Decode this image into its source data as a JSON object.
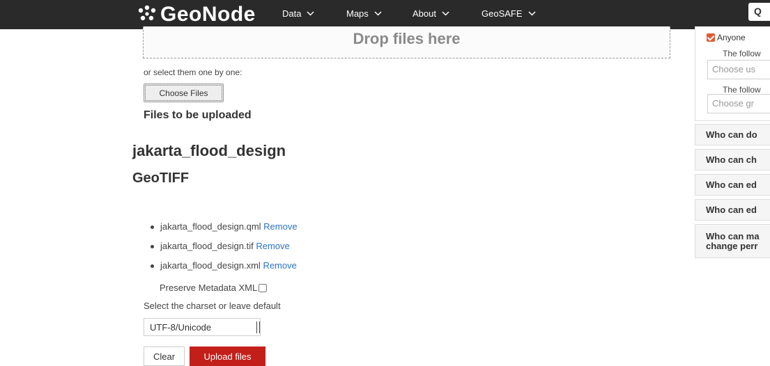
{
  "navbar": {
    "brand": "GeoNode",
    "items": [
      "Data",
      "Maps",
      "About",
      "GeoSAFE"
    ],
    "search_partial": "Q"
  },
  "upload": {
    "drop_text": "Drop files here",
    "select_text": "or select them one by one:",
    "choose_files_label": "Choose Files",
    "files_heading": "Files to be uploaded"
  },
  "layer": {
    "name": "jakarta_flood_design",
    "type": "GeoTIFF",
    "files": [
      {
        "name": "jakarta_flood_design.qml",
        "remove": "Remove"
      },
      {
        "name": "jakarta_flood_design.tif",
        "remove": "Remove"
      },
      {
        "name": "jakarta_flood_design.xml",
        "remove": "Remove"
      }
    ],
    "preserve_metadata_label": "Preserve Metadata XML",
    "preserve_metadata_checked": false
  },
  "charset": {
    "label": "Select the charset or leave default",
    "selected": "UTF-8/Unicode"
  },
  "actions": {
    "clear": "Clear",
    "upload": "Upload files"
  },
  "permissions": {
    "anyone_label": "Anyone",
    "follow_users_text": "The follow",
    "users_placeholder": "Choose us",
    "follow_groups_text": "The follow",
    "groups_placeholder": "Choose gr",
    "rows": [
      "Who can do",
      "Who can ch",
      "Who can ed",
      "Who can ed",
      "Who can ma change perr"
    ]
  },
  "colors": {
    "navbar": "#2a2a2a",
    "upload_button": "#c31f1a",
    "link": "#2c74c6",
    "checkbox_accent": "#e05a34"
  }
}
